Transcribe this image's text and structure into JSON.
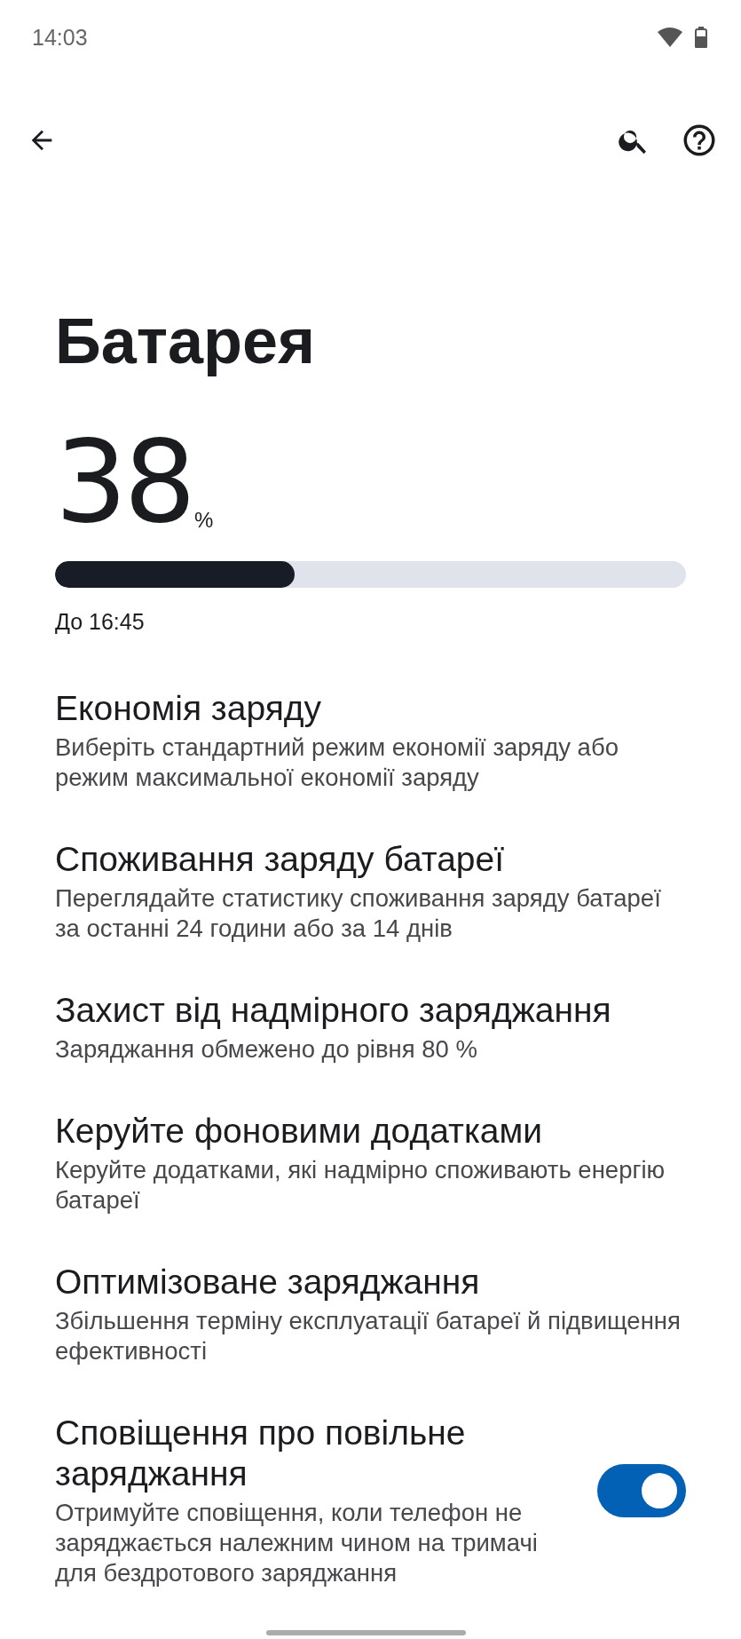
{
  "status_bar": {
    "time": "14:03"
  },
  "page": {
    "title": "Батарея",
    "battery": {
      "percent": "38",
      "unit": "%",
      "level": 0.38,
      "until": "До 16:45"
    }
  },
  "settings": [
    {
      "kind": "item",
      "title": "Економія заряду",
      "summary": "Виберіть стандартний режим економії заряду або режим максимальної економії заряду"
    },
    {
      "kind": "item",
      "title": "Споживання заряду батареї",
      "summary": "Переглядайте статистику споживання заряду батареї за останні 24 години або за 14 днів"
    },
    {
      "kind": "item",
      "title": "Захист від надмірного заряджання",
      "summary": "Заряджання обмежено до рівня 80 %"
    },
    {
      "kind": "item",
      "title": "Керуйте фоновими додатками",
      "summary": "Керуйте додатками, які надмірно споживають енергію батареї"
    },
    {
      "kind": "item",
      "title": "Оптимізоване заряджання",
      "summary": "Збільшення терміну експлуатації батареї й підвищення ефективності"
    },
    {
      "kind": "switch",
      "title": "Сповіщення про повільне заряджання",
      "summary": "Отримуйте сповіщення, коли телефон не заряджається належним чином на тримачі для бездротового заряджання",
      "on": true
    }
  ]
}
